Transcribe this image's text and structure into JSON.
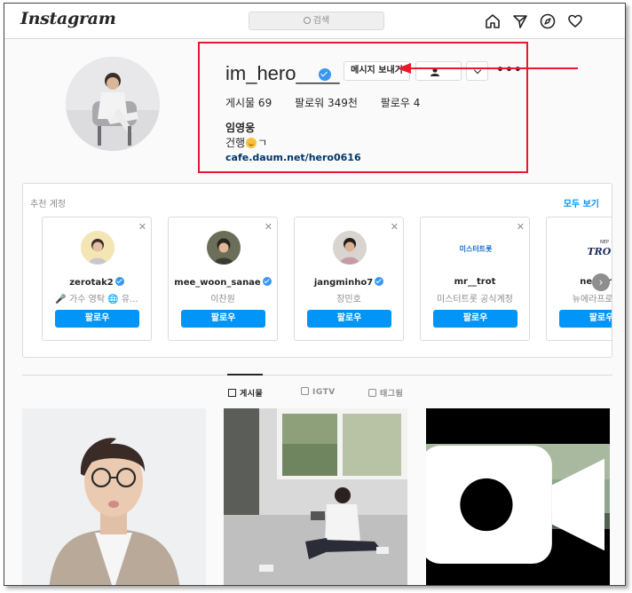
{
  "nav": {
    "logo": "Instagram",
    "search_placeholder": "검색",
    "icons": [
      "home-icon",
      "direct-icon",
      "explore-icon",
      "heart-icon"
    ]
  },
  "profile": {
    "username": "im_hero____",
    "verified": true,
    "message_button": "메시지 보내기",
    "stats": {
      "posts": "게시물 69",
      "followers": "팔로워 349천",
      "following": "팔로우 4"
    },
    "full_name": "임영웅",
    "bio_prefix": "건행",
    "bio_suffix": "ㄱ",
    "link": "cafe.daum.net/hero0616"
  },
  "suggestions": {
    "title": "추천 계정",
    "see_all": "모두 보기",
    "cards": [
      {
        "username": "zerotak2",
        "verified": true,
        "subtitle": "🎤 가수 영탁 🌐 유...",
        "button": "팔로우"
      },
      {
        "username": "mee_woon_sanae",
        "verified": true,
        "subtitle": "이찬원",
        "button": "팔로우"
      },
      {
        "username": "jangminho7",
        "verified": true,
        "subtitle": "장민호",
        "button": "팔로우"
      },
      {
        "username": "mr__trot",
        "verified": false,
        "subtitle": "미스터트롯 공식계정",
        "button": "팔로우"
      },
      {
        "username": "nep_trot",
        "verified": false,
        "subtitle": "뉴에라프로젝트",
        "button": "팔로우"
      }
    ],
    "logo_text": "미스터트롯",
    "logo_text2": "NEP",
    "logo_text3": "TROT"
  },
  "tabs": [
    {
      "label": "게시물",
      "active": true
    },
    {
      "label": "IGTV",
      "active": false
    },
    {
      "label": "태그됨",
      "active": false
    }
  ],
  "colors": {
    "accent": "#0095f6",
    "verified": "#3897f0",
    "highlight": "#e8192c",
    "link": "#00376b"
  }
}
